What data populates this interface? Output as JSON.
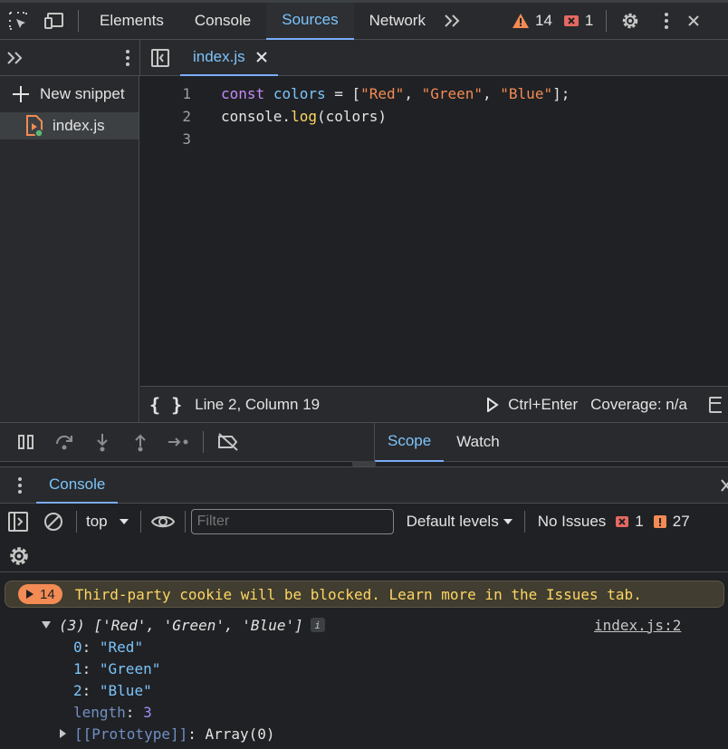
{
  "toolbar": {
    "tabs": [
      "Elements",
      "Console",
      "Sources",
      "Network"
    ],
    "active_tab": "Sources",
    "warnings_count": "14",
    "errors_count": "1"
  },
  "navigator": {
    "new_snippet_label": "New snippet",
    "file_name": "index.js"
  },
  "editor": {
    "tab_label": "index.js",
    "line_numbers": [
      "1",
      "2",
      "3"
    ],
    "status_position": "Line 2, Column 19",
    "run_shortcut": "Ctrl+Enter",
    "coverage": "Coverage: n/a"
  },
  "sidebar_tabs": {
    "scope": "Scope",
    "watch": "Watch"
  },
  "drawer": {
    "tab": "Console",
    "context": "top",
    "filter_placeholder": "Filter",
    "levels": "Default levels",
    "no_issues": "No Issues",
    "issue_errors": "1",
    "issue_warnings": "27"
  },
  "console": {
    "issue_count": "14",
    "issue_message": "Third-party cookie will be blocked. Learn more in the Issues tab.",
    "array_summary": "(3) ['Red', 'Green', 'Blue']",
    "source_link": "index.js:2",
    "entries": [
      {
        "key": "0",
        "value": "\"Red\""
      },
      {
        "key": "1",
        "value": "\"Green\""
      },
      {
        "key": "2",
        "value": "\"Blue\""
      }
    ],
    "length_key": "length",
    "length_value": "3",
    "prototype_key": "[[Prototype]]",
    "prototype_value": "Array(0)"
  },
  "colors": {
    "accent": "#7cc4fa",
    "warning": "#f28b54",
    "error": "#e46962",
    "background": "#202124"
  }
}
